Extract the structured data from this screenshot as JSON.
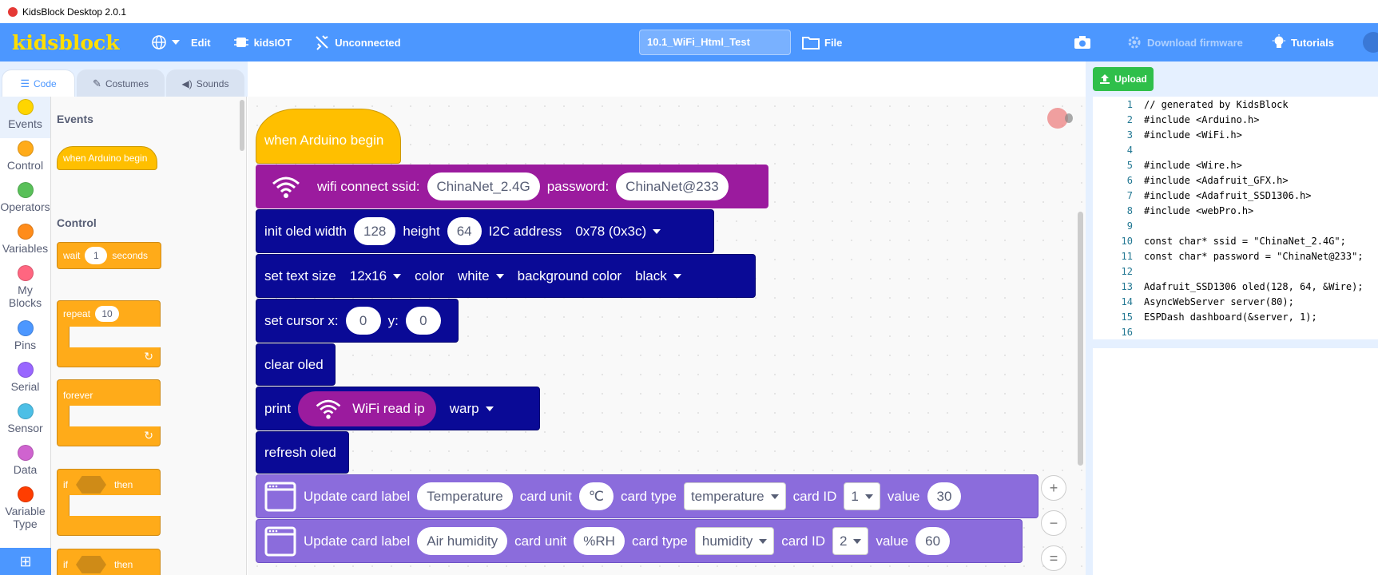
{
  "window": {
    "title": "KidsBlock Desktop 2.0.1"
  },
  "menubar": {
    "logo": "kidsblock",
    "edit": "Edit",
    "kidsiot": "kidsIOT",
    "connection": "Unconnected",
    "project_name": "10.1_WiFi_Html_Test",
    "file": "File",
    "download_firmware": "Download firmware",
    "tutorials": "Tutorials"
  },
  "tabs": {
    "code": "Code",
    "costumes": "Costumes",
    "sounds": "Sounds"
  },
  "categories": [
    {
      "label": "Events",
      "color": "#ffd500"
    },
    {
      "label": "Control",
      "color": "#ffab19"
    },
    {
      "label": "Operators",
      "color": "#59c059"
    },
    {
      "label": "Variables",
      "color": "#ff8c1a"
    },
    {
      "label": "My Blocks",
      "color": "#ff6680"
    },
    {
      "label": "Pins",
      "color": "#4c97ff"
    },
    {
      "label": "Serial",
      "color": "#9966ff"
    },
    {
      "label": "Sensor",
      "color": "#4cbfe6"
    },
    {
      "label": "Data",
      "color": "#cf63cf"
    },
    {
      "label": "Variable Type",
      "color": "#ff3d00"
    }
  ],
  "flyout": {
    "events_heading": "Events",
    "when_begin": "when Arduino begin",
    "control_heading": "Control",
    "wait": "wait",
    "wait_value": "1",
    "seconds": "seconds",
    "repeat": "repeat",
    "repeat_value": "10",
    "forever": "forever",
    "if": "if",
    "then": "then"
  },
  "script": {
    "hat": "when Arduino begin",
    "wifi_connect": "wifi connect ssid:",
    "ssid": "ChinaNet_2.4G",
    "password_label": "password:",
    "password": "ChinaNet@233",
    "init_oled": "init oled width",
    "width": "128",
    "height_label": "height",
    "height": "64",
    "i2c_label": "I2C address",
    "i2c": "0x78 (0x3c)",
    "set_text_size": "set text size",
    "text_size": "12x16",
    "color_label": "color",
    "color": "white",
    "bg_label": "background color",
    "bg": "black",
    "set_cursor": "set cursor x:",
    "cursor_x": "0",
    "y_label": "y:",
    "cursor_y": "0",
    "clear_oled": "clear oled",
    "print": "print",
    "wifi_read_ip": "WiFi read ip",
    "warp": "warp",
    "refresh_oled": "refresh oled",
    "card1": {
      "label": "Update card label",
      "name": "Temperature",
      "unit_label": "card unit",
      "unit": "℃",
      "type_label": "card type",
      "type": "temperature",
      "id_label": "card ID",
      "id": "1",
      "value_label": "value",
      "value": "30"
    },
    "card2": {
      "label": "Update card label",
      "name": "Air humidity",
      "unit_label": "card unit",
      "unit": "%RH",
      "type_label": "card type",
      "type": "humidity",
      "id_label": "card ID",
      "id": "2",
      "value_label": "value",
      "value": "60"
    }
  },
  "code_panel": {
    "upload": "Upload",
    "lines": [
      {
        "n": "1",
        "text": "// generated by KidsBlock"
      },
      {
        "n": "2",
        "text": "#include <Arduino.h>"
      },
      {
        "n": "3",
        "text": "#include <WiFi.h>"
      },
      {
        "n": "4",
        "text": ""
      },
      {
        "n": "5",
        "text": "#include <Wire.h>"
      },
      {
        "n": "6",
        "text": "#include <Adafruit_GFX.h>"
      },
      {
        "n": "7",
        "text": "#include <Adafruit_SSD1306.h>"
      },
      {
        "n": "8",
        "text": "#include <webPro.h>"
      },
      {
        "n": "9",
        "text": ""
      },
      {
        "n": "10",
        "text": "const char* ssid = \"ChinaNet_2.4G\";"
      },
      {
        "n": "11",
        "text": "const char* password = \"ChinaNet@233\";"
      },
      {
        "n": "12",
        "text": ""
      },
      {
        "n": "13",
        "text": "Adafruit_SSD1306 oled(128, 64, &Wire);"
      },
      {
        "n": "14",
        "text": "AsyncWebServer server(80);"
      },
      {
        "n": "15",
        "text": "ESPDash dashboard(&server, 1);"
      },
      {
        "n": "16",
        "text": ""
      }
    ]
  },
  "zoom": {
    "in": "+",
    "out": "−",
    "reset": "="
  }
}
